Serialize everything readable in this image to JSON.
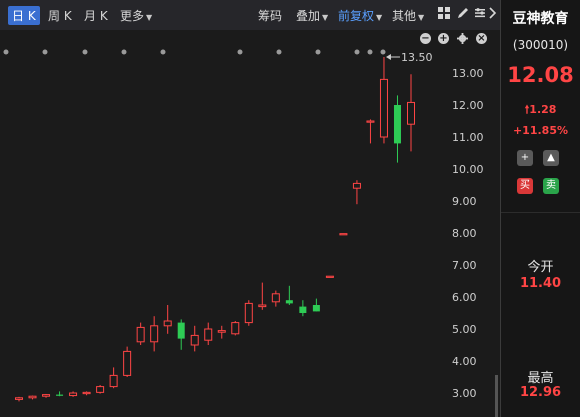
{
  "toolbar": {
    "tab_day": "日 K",
    "tab_week": "周 K",
    "tab_month": "月 K",
    "more": "更多",
    "chips": "筹码",
    "overlay": "叠加",
    "forward_adjust": "前复权",
    "other": "其他"
  },
  "icons": [
    "grid-icon",
    "pen-icon",
    "settings-icon",
    "expand-icon",
    "minus-icon",
    "plus-icon",
    "gear-icon",
    "close-icon",
    "arrow-up-icon",
    "add-icon",
    "bell-icon"
  ],
  "stock": {
    "name": "豆神教育",
    "code": "(300010)",
    "price": "12.08",
    "change": "1.28",
    "change_pct": "+11.85%",
    "buy": "买",
    "sell": "卖",
    "open_label": "今开",
    "open_value": "11.40",
    "high_label": "最高",
    "high_value": "12.96"
  },
  "colors": {
    "up": "#ff4545",
    "down": "#2ecc55",
    "accent": "#3a6fd1",
    "bg": "#1b1b1b"
  },
  "chart_data": {
    "type": "candlestick",
    "max_label": "13.50",
    "y_ticks": [
      "13.00",
      "12.00",
      "11.00",
      "10.00",
      "9.00",
      "8.00",
      "7.00",
      "6.00",
      "5.00",
      "4.00",
      "3.00"
    ],
    "candles": [
      {
        "o": 2.8,
        "h": 2.88,
        "l": 2.74,
        "c": 2.85
      },
      {
        "o": 2.85,
        "h": 2.92,
        "l": 2.8,
        "c": 2.9
      },
      {
        "o": 2.9,
        "h": 2.97,
        "l": 2.85,
        "c": 2.95
      },
      {
        "o": 2.95,
        "h": 3.05,
        "l": 2.9,
        "c": 2.92
      },
      {
        "o": 2.92,
        "h": 3.05,
        "l": 2.88,
        "c": 3.0
      },
      {
        "o": 2.98,
        "h": 3.05,
        "l": 2.93,
        "c": 3.02
      },
      {
        "o": 3.02,
        "h": 3.25,
        "l": 2.98,
        "c": 3.2
      },
      {
        "o": 3.2,
        "h": 3.8,
        "l": 3.15,
        "c": 3.55
      },
      {
        "o": 3.55,
        "h": 4.45,
        "l": 3.5,
        "c": 4.3
      },
      {
        "o": 4.6,
        "h": 5.2,
        "l": 4.5,
        "c": 5.05
      },
      {
        "o": 4.6,
        "h": 5.4,
        "l": 4.3,
        "c": 5.1
      },
      {
        "o": 5.1,
        "h": 5.75,
        "l": 4.85,
        "c": 5.25
      },
      {
        "o": 5.2,
        "h": 5.3,
        "l": 4.35,
        "c": 4.7
      },
      {
        "o": 4.5,
        "h": 5.1,
        "l": 4.3,
        "c": 4.8
      },
      {
        "o": 4.65,
        "h": 5.2,
        "l": 4.5,
        "c": 5.0
      },
      {
        "o": 4.9,
        "h": 5.1,
        "l": 4.7,
        "c": 4.95
      },
      {
        "o": 4.85,
        "h": 5.25,
        "l": 4.8,
        "c": 5.2
      },
      {
        "o": 5.2,
        "h": 5.9,
        "l": 5.1,
        "c": 5.8
      },
      {
        "o": 5.7,
        "h": 6.45,
        "l": 5.6,
        "c": 5.75
      },
      {
        "o": 5.85,
        "h": 6.2,
        "l": 5.7,
        "c": 6.1
      },
      {
        "o": 5.9,
        "h": 6.35,
        "l": 5.75,
        "c": 5.8
      },
      {
        "o": 5.7,
        "h": 5.9,
        "l": 5.4,
        "c": 5.5
      },
      {
        "o": 5.75,
        "h": 5.95,
        "l": 5.55,
        "c": 5.55
      },
      {
        "o": 6.65,
        "h": 6.65,
        "l": 6.65,
        "c": 6.65
      },
      {
        "o": 7.98,
        "h": 7.98,
        "l": 7.98,
        "c": 7.98
      },
      {
        "o": 9.4,
        "h": 9.65,
        "l": 8.9,
        "c": 9.55
      },
      {
        "o": 11.5,
        "h": 11.55,
        "l": 10.8,
        "c": 11.5
      },
      {
        "o": 11.0,
        "h": 13.5,
        "l": 10.8,
        "c": 12.8
      },
      {
        "o": 12.0,
        "h": 12.3,
        "l": 10.2,
        "c": 10.8
      },
      {
        "o": 11.4,
        "h": 12.96,
        "l": 10.55,
        "c": 12.08
      }
    ]
  }
}
